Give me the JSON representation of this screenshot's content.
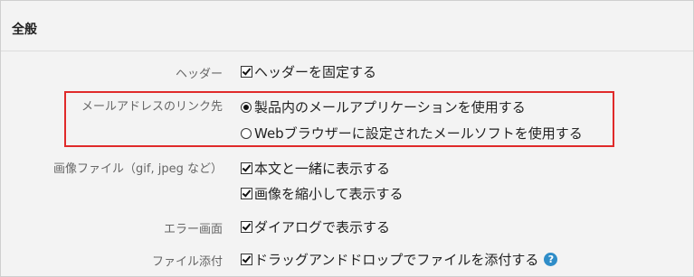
{
  "section": {
    "title": "全般"
  },
  "rows": {
    "header": {
      "label": "ヘッダー",
      "option": "ヘッダーを固定する"
    },
    "mail_link": {
      "label": "メールアドレスのリンク先",
      "option_1": "製品内のメールアプリケーションを使用する",
      "option_2": "Webブラウザーに設定されたメールソフトを使用する"
    },
    "image_file": {
      "label": "画像ファイル（gif, jpeg など）",
      "option_1": "本文と一緒に表示する",
      "option_2": "画像を縮小して表示する"
    },
    "error_screen": {
      "label": "エラー画面",
      "option": "ダイアログで表示する"
    },
    "file_attach": {
      "label": "ファイル添付",
      "option": "ドラッグアンドドロップでファイルを添付する"
    }
  },
  "help_icon_glyph": "?",
  "colors": {
    "highlight_border": "#e02a2a",
    "help_icon": "#2f8dc8",
    "label_text": "#666666"
  }
}
